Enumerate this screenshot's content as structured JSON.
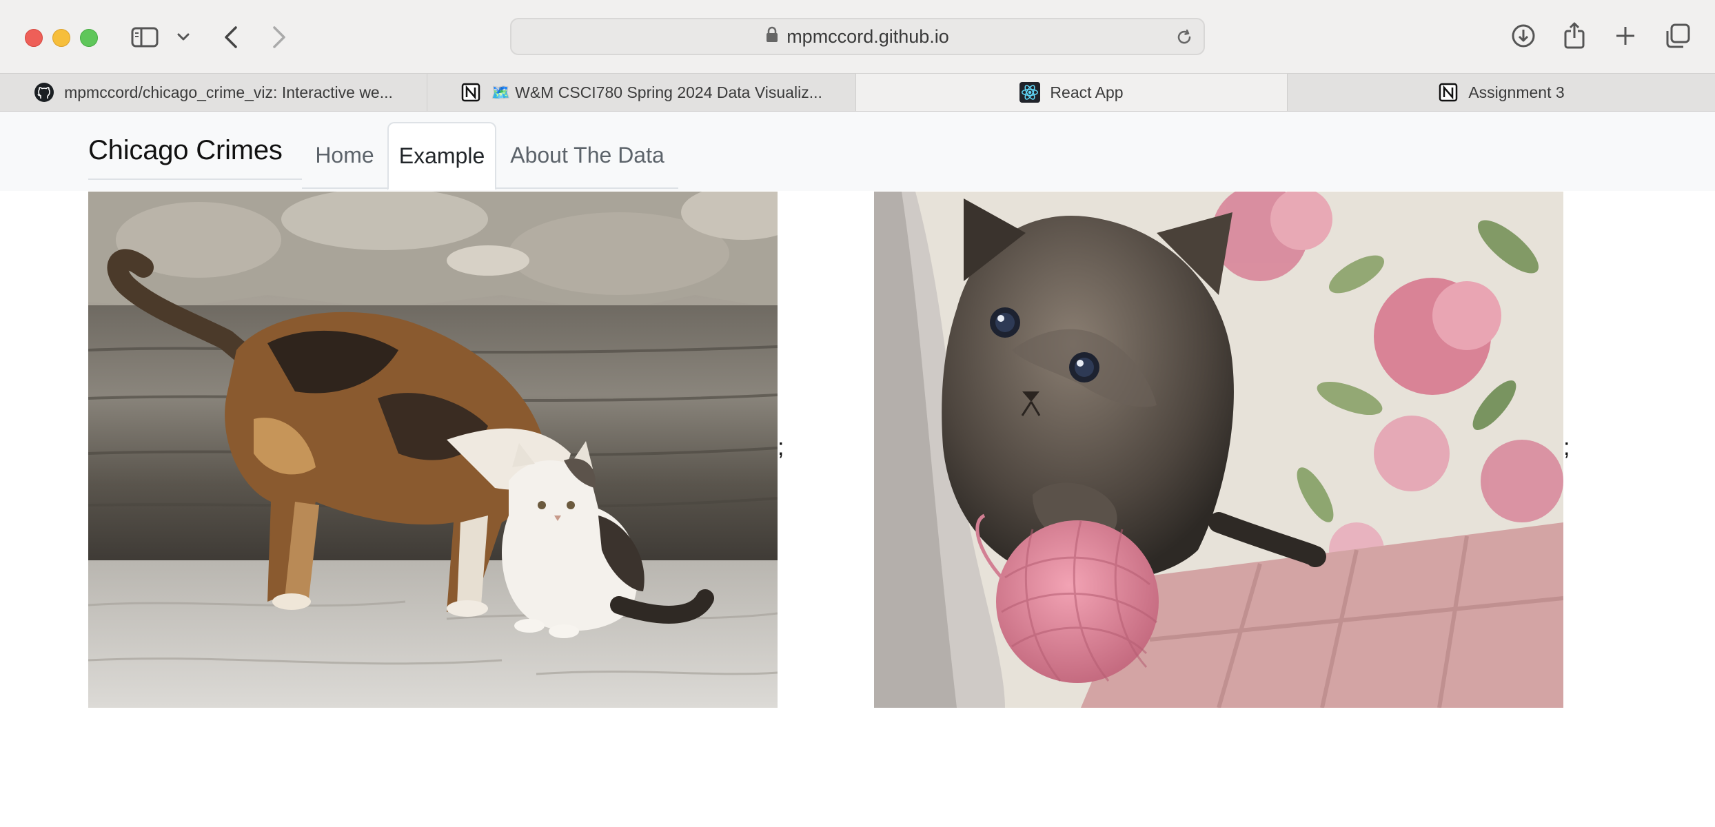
{
  "browser": {
    "url": "mpmccord.github.io",
    "tabs": [
      {
        "title": "mpmccord/chicago_crime_viz: Interactive we...",
        "favicon": "github-icon",
        "active": false
      },
      {
        "title": "🗺️ W&M CSCI780 Spring 2024 Data Visualiz...",
        "favicon": "notion-icon",
        "active": false
      },
      {
        "title": "React App",
        "favicon": "react-icon",
        "active": true
      },
      {
        "title": "Assignment 3",
        "favicon": "notion-icon",
        "active": false
      }
    ]
  },
  "navbar": {
    "brand": "Chicago Crimes",
    "links": [
      {
        "label": "Home",
        "active": false
      },
      {
        "label": "Example",
        "active": true
      },
      {
        "label": "About The Data",
        "active": false
      }
    ]
  },
  "content": {
    "images": [
      {
        "name": "calico-cat-with-kitten-photo",
        "trailing_text": ";"
      },
      {
        "name": "kitten-with-yarn-ball-photo",
        "trailing_text": ";"
      }
    ]
  }
}
